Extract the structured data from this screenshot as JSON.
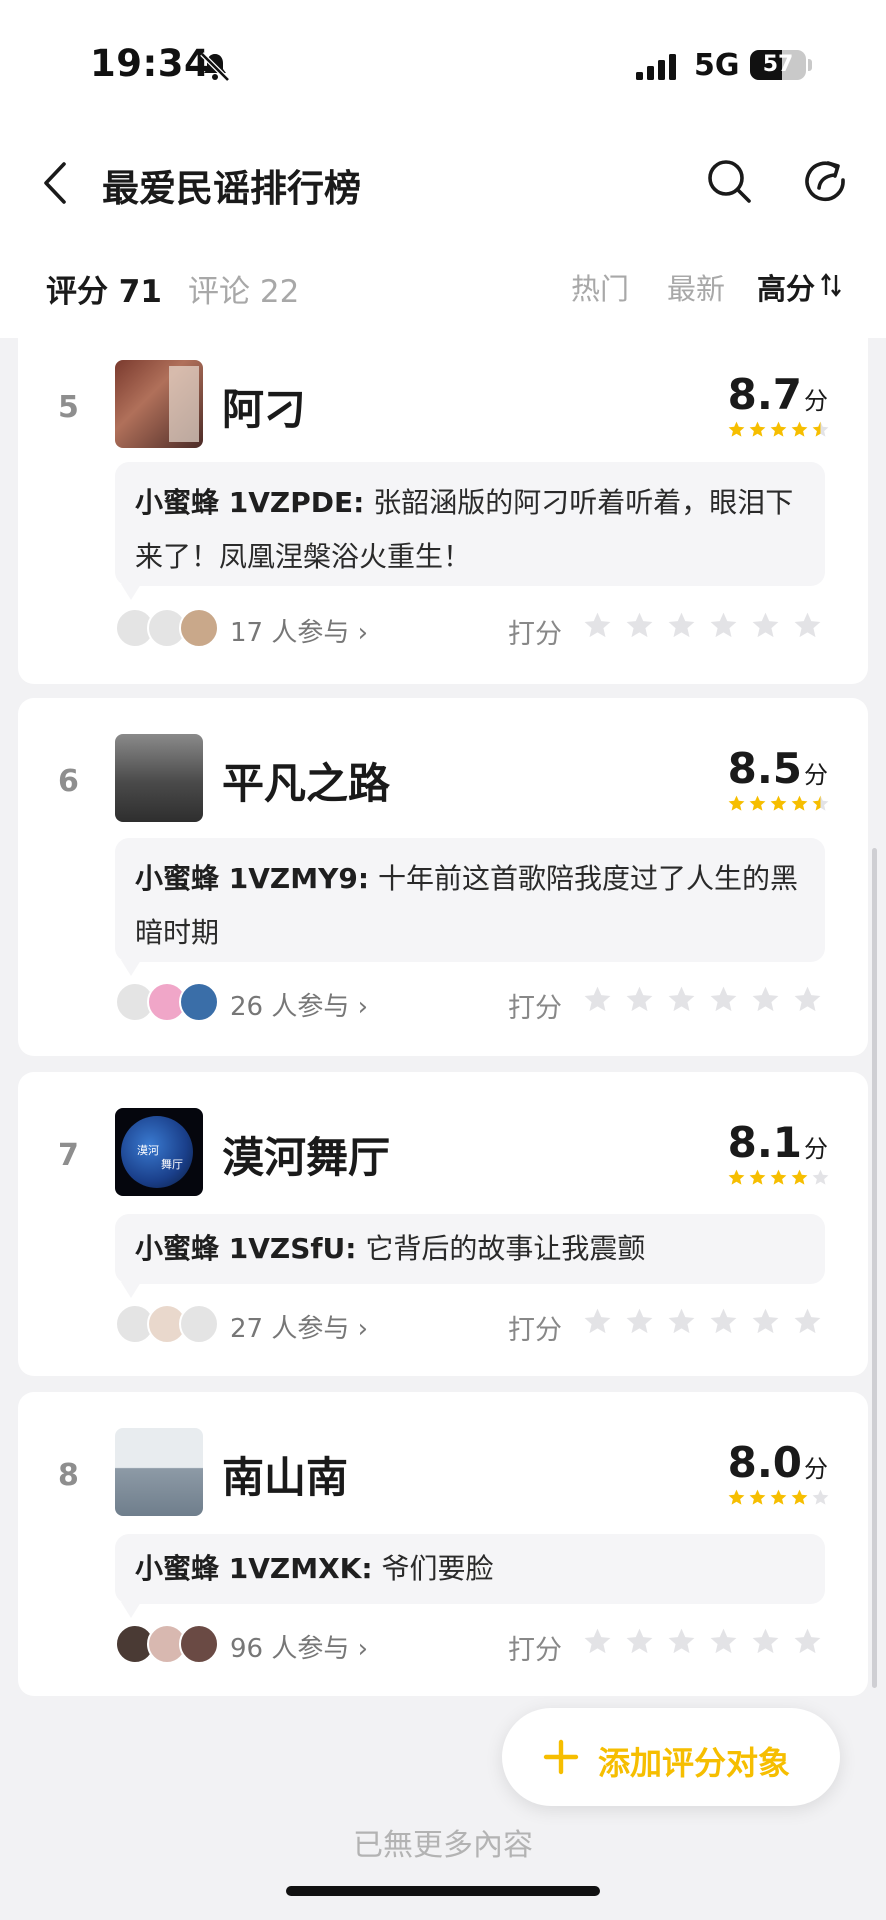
{
  "status_bar": {
    "time": "19:34",
    "network": "5G",
    "battery": "57",
    "battery_level": 0.57
  },
  "nav": {
    "title": "最爱民谣排行榜"
  },
  "tabs": {
    "score": "评分 71",
    "comment": "评论 22"
  },
  "sort": {
    "hot": "热门",
    "new": "最新",
    "high": "高分"
  },
  "colors": {
    "accent": "#f6be00",
    "star_empty": "#e3e3e6",
    "page_bg": "#f2f2f4"
  },
  "items": [
    {
      "rank": "5",
      "title": "阿刁",
      "score": "8.7",
      "score_unit": "分",
      "stars": 4.5,
      "comment_user": "小蜜蜂 1VZPDE:",
      "comment_text": "张韶涵版的阿刁听着听着，眼泪下来了！凤凰涅槃浴火重生！",
      "participants": "17 人参与 ›",
      "rate_label": "打分"
    },
    {
      "rank": "6",
      "title": "平凡之路",
      "score": "8.5",
      "score_unit": "分",
      "stars": 4.5,
      "comment_user": "小蜜蜂 1VZMY9:",
      "comment_text": "十年前这首歌陪我度过了人生的黑暗时期",
      "participants": "26 人参与 ›",
      "rate_label": "打分"
    },
    {
      "rank": "7",
      "title": "漠河舞厅",
      "score": "8.1",
      "score_unit": "分",
      "stars": 4,
      "comment_user": "小蜜蜂 1VZSfU:",
      "comment_text": "它背后的故事让我震颤",
      "participants": "27 人参与 ›",
      "rate_label": "打分",
      "cover_text": [
        "漠河",
        "舞厅"
      ]
    },
    {
      "rank": "8",
      "title": "南山南",
      "score": "8.0",
      "score_unit": "分",
      "stars": 4,
      "comment_user": "小蜜蜂 1VZMXK:",
      "comment_text": "爷们要脸",
      "participants": "96 人参与 ›",
      "rate_label": "打分"
    }
  ],
  "footer": {
    "add_button": "添加评分对象",
    "end_text": "已無更多內容"
  }
}
